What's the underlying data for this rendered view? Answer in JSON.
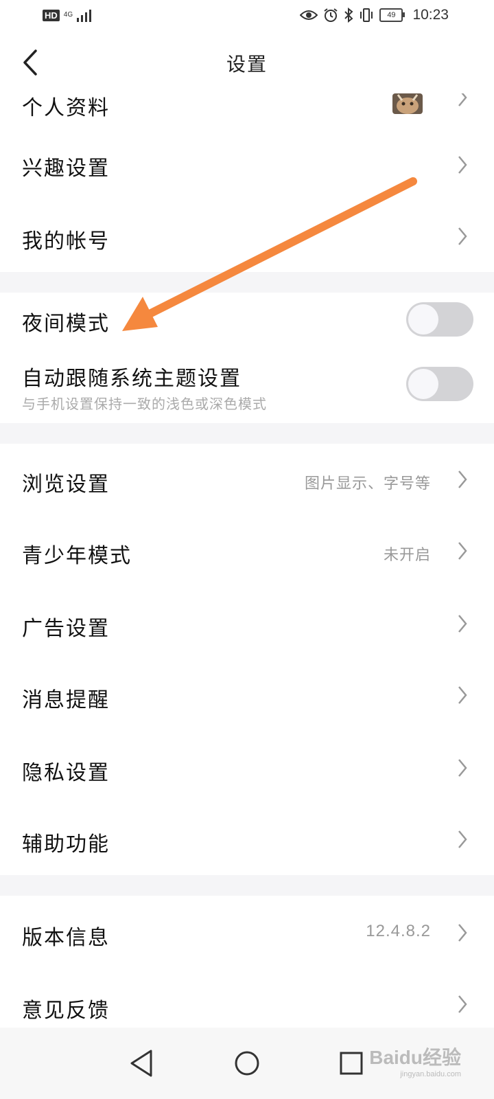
{
  "status_bar": {
    "hd": "HD",
    "network": "4G",
    "battery": "49",
    "time": "10:23"
  },
  "header": {
    "title": "设置",
    "back_icon": "chevron-left-icon"
  },
  "sections": {
    "profile": {
      "label": "个人资料"
    },
    "interest": {
      "label": "兴趣设置"
    },
    "account": {
      "label": "我的帐号"
    },
    "night_mode": {
      "label": "夜间模式",
      "enabled": false
    },
    "follow_system": {
      "label": "自动跟随系统主题设置",
      "sub": "与手机设置保持一致的浅色或深色模式",
      "enabled": false
    },
    "browse": {
      "label": "浏览设置",
      "value": "图片显示、字号等"
    },
    "teen": {
      "label": "青少年模式",
      "value": "未开启"
    },
    "ads": {
      "label": "广告设置"
    },
    "notify": {
      "label": "消息提醒"
    },
    "privacy": {
      "label": "隐私设置"
    },
    "accessibility": {
      "label": "辅助功能"
    },
    "version": {
      "label": "版本信息",
      "value": "12.4.8.2"
    },
    "feedback": {
      "label": "意见反馈"
    }
  },
  "nav": {
    "back_icon": "triangle-back-icon",
    "home_icon": "circle-home-icon",
    "recents_icon": "square-recents-icon"
  },
  "watermark": {
    "brand": "Baidu经验",
    "site": "jingyan.baidu.com"
  },
  "colors": {
    "arrow": "#f5883e",
    "toggle_off": "#d3d3d6",
    "section_gap": "#f5f5f7",
    "secondary_text": "#999999"
  }
}
